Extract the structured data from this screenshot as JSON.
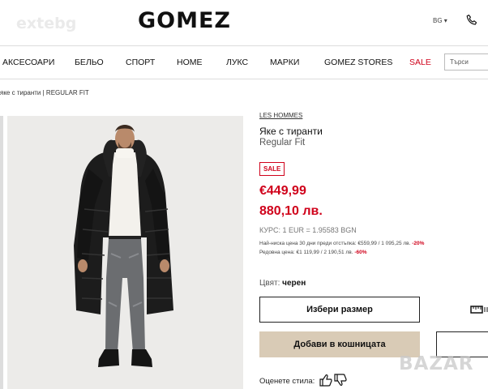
{
  "watermark_top": "extebg",
  "logo": "GOMEZ",
  "lang": "BG ▾",
  "nav": {
    "items": [
      "АКСЕСОАРИ",
      "БЕЛЬО",
      "СПОРТ",
      "HOME",
      "ЛУКС",
      "МАРКИ",
      "GOMEZ STORES",
      "SALE"
    ],
    "search_placeholder": "Търси"
  },
  "breadcrumb": "яке с тиранти | REGULAR FIT",
  "product": {
    "brand": "LES HOMMES",
    "title": "Яке с тиранти",
    "subtitle": "Regular Fit",
    "badge": "SALE",
    "price_eur": "€449,99",
    "price_bgn": "880,10 лв.",
    "rate": "КУРС: 1 EUR = 1.95583 BGN",
    "lowest_label": "Най-ниска цена 30 дни преди отстъпка: €559,99 / 1 095,25 лв.",
    "lowest_pct": "-20%",
    "regular_label": "Редовна цена: €1 119,99 / 2 190,51 лв.",
    "regular_pct": "-60%",
    "color_label": "Цвят:",
    "color_value": "черен",
    "size_button": "Избери размер",
    "cart_button": "Добави в кошницата",
    "rate_style": "Оценете стила:"
  },
  "watermark_bottom": "BAZAR",
  "colors": {
    "accent": "#d0021b",
    "cart_bg": "#d9cbb6"
  }
}
